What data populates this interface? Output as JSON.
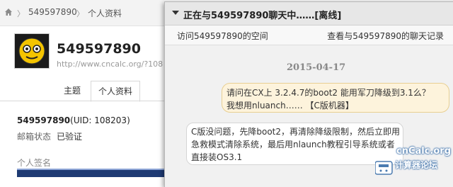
{
  "breadcrumb": {
    "user": "549597890",
    "section": "个人资料"
  },
  "profile": {
    "name": "549597890",
    "url": "http://www.cncalc.org/?108",
    "tabs": [
      "主题",
      "个人资料"
    ],
    "uid_name": "549597890",
    "uid_text": "(UID: 108203)",
    "email_label": "邮箱状态",
    "email_value": "已验证",
    "signature_label": "个人签名"
  },
  "chat": {
    "title": "正在与549597890聊天中……[离线]",
    "visit_link": "访问549597890的空间",
    "history_link": "查看与549597890的聊天记录",
    "date": "2015-04-17",
    "messages": [
      {
        "side": "right",
        "lines": [
          "请问在CX上 3.2.4.7的boot2 能用军刀降级到3.1么？",
          "我想用nluanch…… 【C版机器】"
        ]
      },
      {
        "side": "left",
        "lines": [
          "C版没问题，先降boot2，再清除降级限制，然后立即用",
          "急救模式清除系统，最后用nlaunch教程引导系统或者",
          "直接装OS3.1"
        ]
      }
    ]
  },
  "watermark": {
    "line1": "cnCalc.org",
    "line2": "计算器论坛"
  }
}
